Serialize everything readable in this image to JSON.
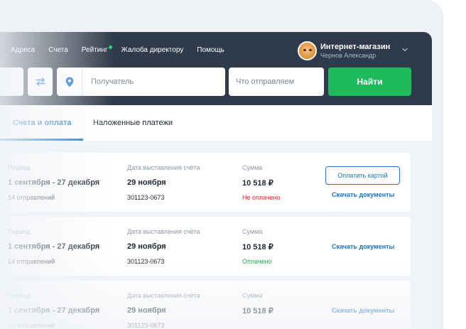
{
  "nav": {
    "items": [
      {
        "label": "Адреса"
      },
      {
        "label": "Счета"
      },
      {
        "label": "Рейтинг",
        "has_dot": true
      },
      {
        "label": "Жалоба директору"
      },
      {
        "label": "Помощь"
      }
    ]
  },
  "user": {
    "name": "Интернет-магазин",
    "person": "Чернов Александр"
  },
  "search": {
    "recipient_placeholder": "Получатель",
    "what_placeholder": "Что отправляем",
    "find_label": "Найти"
  },
  "tabs": [
    {
      "label": "Счета и оплата",
      "active": true
    },
    {
      "label": "Наложенные платежи",
      "active": false
    }
  ],
  "invoice_labels": {
    "period": "Период",
    "issue_date": "Дата выставления счёта",
    "amount": "Сумма"
  },
  "invoices": [
    {
      "period": "1 сентября - 27 декабря",
      "shipments": "14 отправлений",
      "date": "29 ноября",
      "number": "301123-0673",
      "amount": "10 518 ₽",
      "status": "Не оплачено",
      "pay_label": "Оплатить картой",
      "download_label": "Скачать документы"
    },
    {
      "period": "1 сентября - 27 декабря",
      "shipments": "14 отправлений",
      "date": "29 ноября",
      "number": "301123-0673",
      "amount": "10 518 ₽",
      "status": "Оплачено",
      "download_label": "Скачать документы"
    },
    {
      "period": "1 сентября - 27 декабря",
      "shipments": "14 отправлений",
      "date": "29 ноября",
      "number": "301123-0673",
      "amount": "10 518 ₽",
      "status": "",
      "download_label": "Скачать документы"
    }
  ],
  "colors": {
    "header_bg": "#2f3a4a",
    "accent_blue": "#1a73c6",
    "find_green": "#1dbb5c",
    "unpaid_red": "#e02c2c",
    "paid_green": "#17a84c",
    "rating_dot": "#29d16c"
  },
  "icons": {
    "swap": "swap-arrows-icon",
    "location": "location-pin-icon",
    "dropdown": "chevron-down-icon",
    "avatar": "cat-avatar"
  }
}
